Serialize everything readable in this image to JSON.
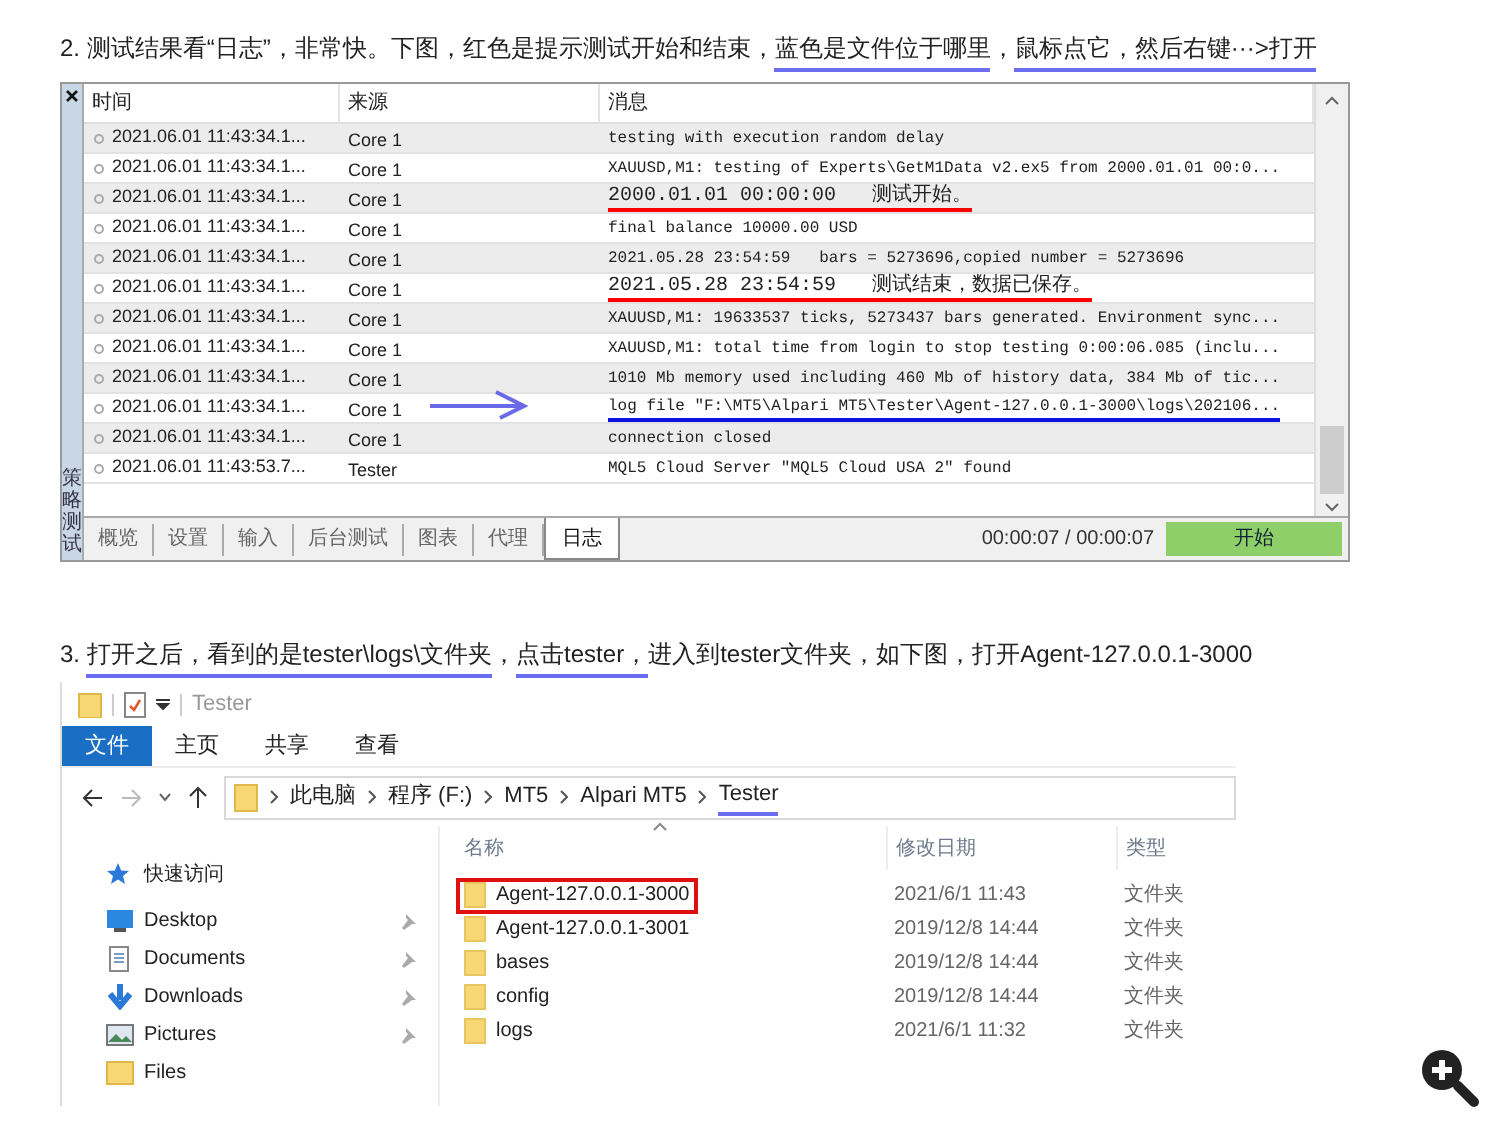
{
  "step_2": {
    "segments": [
      {
        "text": "2. 测试结果看“日志”，非常快。下图，红色是提示测试开始和结束，",
        "underlined": false
      },
      {
        "text": "蓝色是文件位于哪里",
        "underlined": true
      },
      {
        "text": "，",
        "underlined": false
      },
      {
        "text": "鼠标点它，然后右键···>打开",
        "underlined": true
      }
    ]
  },
  "log_panel": {
    "side_label": "策略测试",
    "columns": [
      "时间",
      "来源",
      "消息"
    ],
    "rows": [
      {
        "time": "2021.06.01 11:43:34.1...",
        "source": "Core 1",
        "message": "testing with execution random delay",
        "underlined": false,
        "arrow": false
      },
      {
        "time": "2021.06.01 11:43:34.1...",
        "source": "Core 1",
        "message": "XAUUSD,M1: testing of Experts\\GetM1Data v2.ex5 from 2000.01.01 00:0...",
        "underlined": false,
        "arrow": false
      },
      {
        "time": "2021.06.01 11:43:34.1...",
        "source": "Core 1",
        "message": "2000.01.01 00:00:00   测试开始。",
        "underlined": true,
        "color": "#ff0000",
        "arrow": false
      },
      {
        "time": "2021.06.01 11:43:34.1...",
        "source": "Core 1",
        "message": "final balance 10000.00 USD",
        "underlined": false,
        "arrow": false
      },
      {
        "time": "2021.06.01 11:43:34.1...",
        "source": "Core 1",
        "message": "2021.05.28 23:54:59   bars = 5273696,copied number = 5273696",
        "underlined": false,
        "arrow": false
      },
      {
        "time": "2021.06.01 11:43:34.1...",
        "source": "Core 1",
        "message": "2021.05.28 23:54:59   测试结束，数据已保存。",
        "underlined": true,
        "color": "#ff0000",
        "arrow": false
      },
      {
        "time": "2021.06.01 11:43:34.1...",
        "source": "Core 1",
        "message": "XAUUSD,M1: 19633537 ticks, 5273437 bars generated. Environment sync...",
        "underlined": false,
        "arrow": false
      },
      {
        "time": "2021.06.01 11:43:34.1...",
        "source": "Core 1",
        "message": "XAUUSD,M1: total time from login to stop testing 0:00:06.085 (inclu...",
        "underlined": false,
        "arrow": false
      },
      {
        "time": "2021.06.01 11:43:34.1...",
        "source": "Core 1",
        "message": "1010 Mb memory used including 460 Mb of history data, 384 Mb of tic...",
        "underlined": false,
        "arrow": false
      },
      {
        "time": "2021.06.01 11:43:34.1...",
        "source": "Core 1",
        "message": "log file \"F:\\MT5\\Alpari MT5\\Tester\\Agent-127.0.0.1-3000\\logs\\202106...",
        "underlined": true,
        "color": "#1010e0",
        "arrow": true
      },
      {
        "time": "2021.06.01 11:43:34.1...",
        "source": "Core 1",
        "message": "connection closed",
        "underlined": false,
        "arrow": false
      },
      {
        "time": "2021.06.01 11:43:53.7...",
        "source": "Tester",
        "message": "MQL5 Cloud Server \"MQL5 Cloud USA 2\" found",
        "underlined": false,
        "arrow": false
      }
    ],
    "tabs": [
      {
        "label": "概览",
        "selected": false
      },
      {
        "label": "设置",
        "selected": false
      },
      {
        "label": "输入",
        "selected": false
      },
      {
        "label": "后台测试",
        "selected": false
      },
      {
        "label": "图表",
        "selected": false
      },
      {
        "label": "代理",
        "selected": false
      },
      {
        "label": "日志",
        "selected": true
      }
    ],
    "elapsed": "00:00:07 / 00:00:07",
    "start_button": "开始"
  },
  "step_3": {
    "segments": [
      {
        "text": "3. ",
        "underlined": false
      },
      {
        "text": "打开之后，看到的是tester\\logs\\文件夹",
        "underlined": true
      },
      {
        "text": "，",
        "underlined": false
      },
      {
        "text": "点击tester，",
        "underlined": true
      },
      {
        "text": "进入到tester文件夹，如下图，打开Agent-127.0.0.1-3000",
        "underlined": false
      }
    ]
  },
  "explorer": {
    "title": "Tester",
    "ribbon_tabs": [
      {
        "label": "文件",
        "selected": true
      },
      {
        "label": "主页",
        "selected": false
      },
      {
        "label": "共享",
        "selected": false
      },
      {
        "label": "查看",
        "selected": false
      }
    ],
    "path": [
      {
        "label": "此电脑",
        "underlined": false
      },
      {
        "label": "程序 (F:)",
        "underlined": false
      },
      {
        "label": "MT5",
        "underlined": false
      },
      {
        "label": "Alpari MT5",
        "underlined": false
      },
      {
        "label": "Tester",
        "underlined": true
      }
    ],
    "nav": [
      {
        "kind": "quick",
        "label": "快速访问",
        "pinned": false
      },
      {
        "kind": "desktop",
        "label": "Desktop",
        "pinned": true
      },
      {
        "kind": "documents",
        "label": "Documents",
        "pinned": true
      },
      {
        "kind": "downloads",
        "label": "Downloads",
        "pinned": true
      },
      {
        "kind": "pictures",
        "label": "Pictures",
        "pinned": true
      },
      {
        "kind": "folder",
        "label": "Files",
        "pinned": false
      }
    ],
    "columns": [
      "名称",
      "修改日期",
      "类型"
    ],
    "files": [
      {
        "name": "Agent-127.0.0.1-3000",
        "modified": "2021/6/1 11:43",
        "type": "文件夹",
        "boxed": true
      },
      {
        "name": "Agent-127.0.0.1-3001",
        "modified": "2019/12/8 14:44",
        "type": "文件夹",
        "boxed": false
      },
      {
        "name": "bases",
        "modified": "2019/12/8 14:44",
        "type": "文件夹",
        "boxed": false
      },
      {
        "name": "config",
        "modified": "2019/12/8 14:44",
        "type": "文件夹",
        "boxed": false
      },
      {
        "name": "logs",
        "modified": "2021/6/1 11:32",
        "type": "文件夹",
        "boxed": false
      }
    ]
  }
}
